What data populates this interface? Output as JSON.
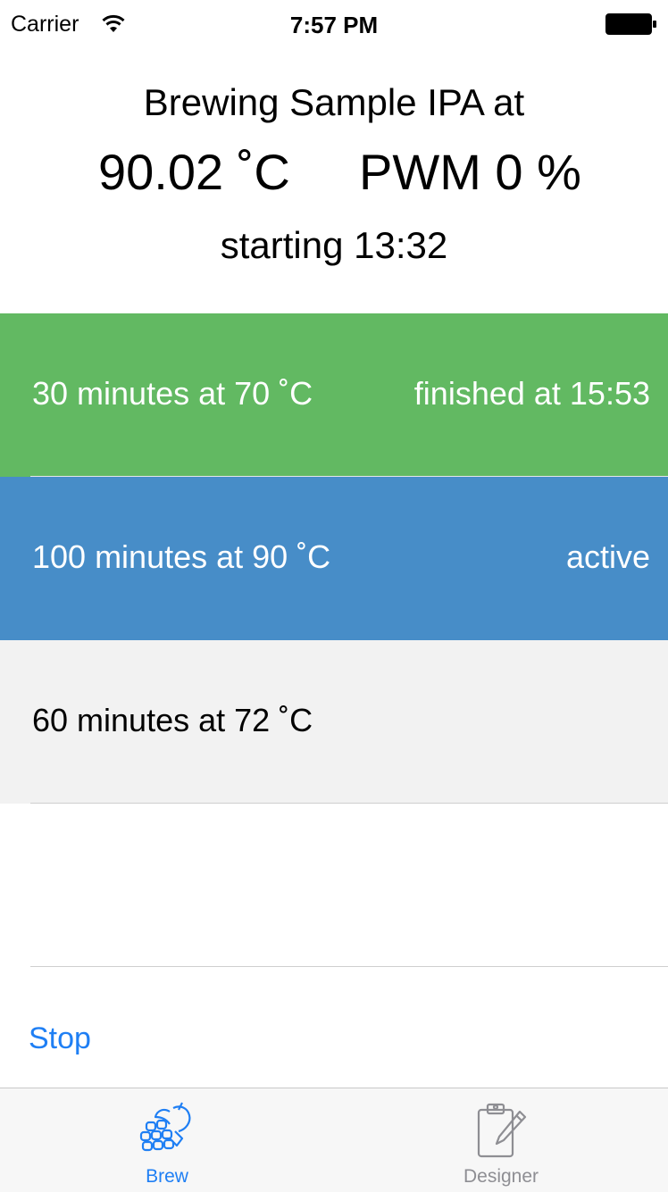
{
  "status_bar": {
    "carrier": "Carrier",
    "time": "7:57 PM",
    "wifi_icon": "wifi-icon",
    "battery_icon": "battery-icon"
  },
  "header": {
    "title": "Brewing Sample IPA at",
    "temperature": "90.02 ˚C",
    "pwm": "PWM 0 %",
    "starting": "starting 13:32"
  },
  "steps": [
    {
      "label": "30 minutes at 70 ˚C",
      "status": "finished at 15:53",
      "state": "finished",
      "color": "#62b962"
    },
    {
      "label": "100 minutes at 90 ˚C",
      "status": "active",
      "state": "active",
      "color": "#478dc8"
    },
    {
      "label": "60 minutes at 72 ˚C",
      "status": "",
      "state": "pending",
      "color": "#f2f2f2"
    }
  ],
  "actions": {
    "stop_label": "Stop"
  },
  "tab_bar": {
    "tabs": [
      {
        "label": "Brew",
        "icon": "hop-icon",
        "selected": true
      },
      {
        "label": "Designer",
        "icon": "clipboard-pencil-icon",
        "selected": false
      }
    ]
  },
  "colors": {
    "accent": "#1f7ff4",
    "finished": "#62b962",
    "active": "#478dc8",
    "pending": "#f2f2f2"
  }
}
